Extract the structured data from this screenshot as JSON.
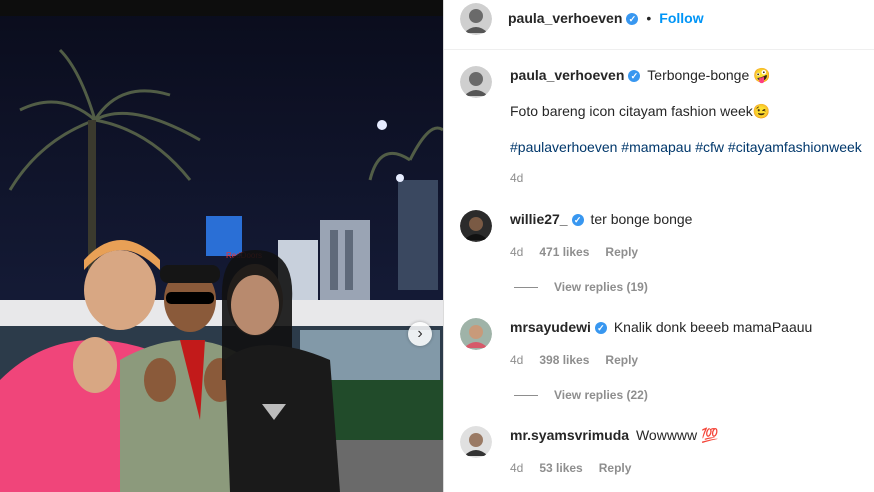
{
  "header": {
    "username": "paula_verhoeven",
    "separator": "•",
    "follow_label": "Follow"
  },
  "caption": {
    "username": "paula_verhoeven",
    "title": "Terbonge-bonge 🤪",
    "line2": "Foto bareng icon citayam fashion week😉",
    "hashtags": "#paulaverhoeven #mamapau #cfw #citayamfashionweek",
    "time": "4d"
  },
  "comments": [
    {
      "username": "willie27_",
      "text": "ter bonge bonge",
      "time": "4d",
      "likes": "471 likes",
      "reply_label": "Reply",
      "view_replies": "View replies (19)"
    },
    {
      "username": "mrsayudewi",
      "text": "Knalik donk beeeb mamaPaauu",
      "time": "4d",
      "likes": "398 likes",
      "reply_label": "Reply",
      "view_replies": "View replies (22)"
    },
    {
      "username": "mr.syamsvrimuda",
      "text": "Wowwww 💯",
      "time": "4d",
      "likes": "53 likes",
      "reply_label": "Reply"
    }
  ],
  "icons": {
    "verified": "verified-badge-icon",
    "next": "chevron-right-icon"
  },
  "colors": {
    "follow": "#0095f6",
    "hashtag": "#00376b",
    "verified": "#3897f0"
  }
}
